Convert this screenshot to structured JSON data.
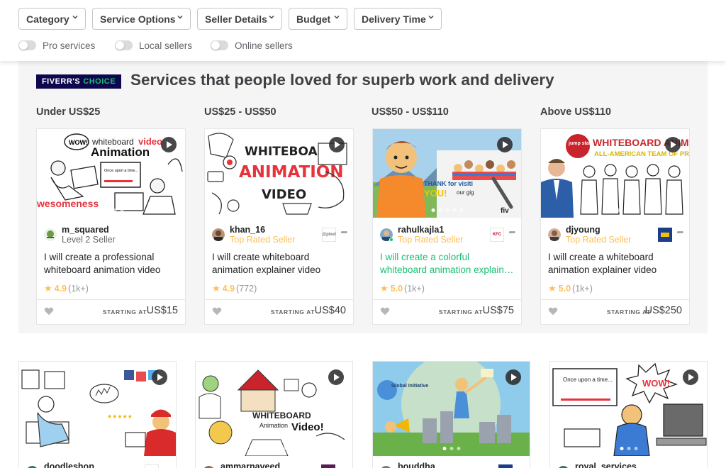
{
  "filters": {
    "dropdowns": [
      "Category",
      "Service Options",
      "Seller Details",
      "Budget",
      "Delivery Time"
    ],
    "toggles": [
      "Pro services",
      "Local sellers",
      "Online sellers"
    ]
  },
  "choice": {
    "badge_main": "FIVERR'S",
    "badge_accent": "CHOICE",
    "title": "Services that people loved for superb work and delivery",
    "columns": [
      {
        "heading": "Under US$25",
        "seller": "m_squared",
        "level": "Level 2 Seller",
        "title": "I will create a professional whiteboard animation video",
        "rating": "4.9",
        "count": "(1k+)",
        "starting": "STARTING AT",
        "price": "US$15"
      },
      {
        "heading": "US$25 - US$50",
        "seller": "khan_16",
        "level": "Top Rated Seller",
        "title": "I will create whiteboard animation explainer video",
        "rating": "4.9",
        "count": "(772)",
        "starting": "STARTING AT",
        "price": "US$40"
      },
      {
        "heading": "US$50 - US$110",
        "seller": "rahulkajla1",
        "level": "Top Rated Seller",
        "title": "I will create a colorful whiteboard animation explainer video",
        "rating": "5.0",
        "count": "(1k+)",
        "starting": "STARTING AT",
        "price": "US$75"
      },
      {
        "heading": "Above US$110",
        "seller": "djyoung",
        "level": "Top Rated Seller",
        "title": "I will create a whiteboard animation explainer video",
        "rating": "5.0",
        "count": "(1k+)",
        "starting": "STARTING AT",
        "price": "US$250"
      }
    ]
  },
  "thumb_text": {
    "c1_top": "whiteboard",
    "c1_video": "video",
    "c1_anim": "Animation",
    "c1_wow": "WOW!",
    "c1_once": "Once upon a time...",
    "c1_bottom": "wesomeness",
    "c2_l1": "WHITEBOARD",
    "c2_l2": "ANIMATION",
    "c2_l3": "VIDEO",
    "c3_thanks": "THANK for visiti",
    "c3_you": "YOU!",
    "c3_gig": "our gig",
    "c3_fiv": "fiv",
    "c4_jump": "jump start",
    "c4_l1": "WHITEBOARD ANIMA",
    "c4_l2": "ALL-AMERICAN TEAM OF PRO"
  },
  "brand_text": {
    "b2": "@pixel",
    "b3": "KFC"
  },
  "lower": {
    "sellers": [
      "doodleshop",
      "ammarnaveed",
      "bouddha",
      "royal_services"
    ],
    "thumb2": [
      "WHITEBOARD",
      "Animation",
      "Video!"
    ],
    "thumb3": "Global Initiative",
    "thumb4_once": "Once upon a time...",
    "thumb4_wow": "WOW!"
  }
}
